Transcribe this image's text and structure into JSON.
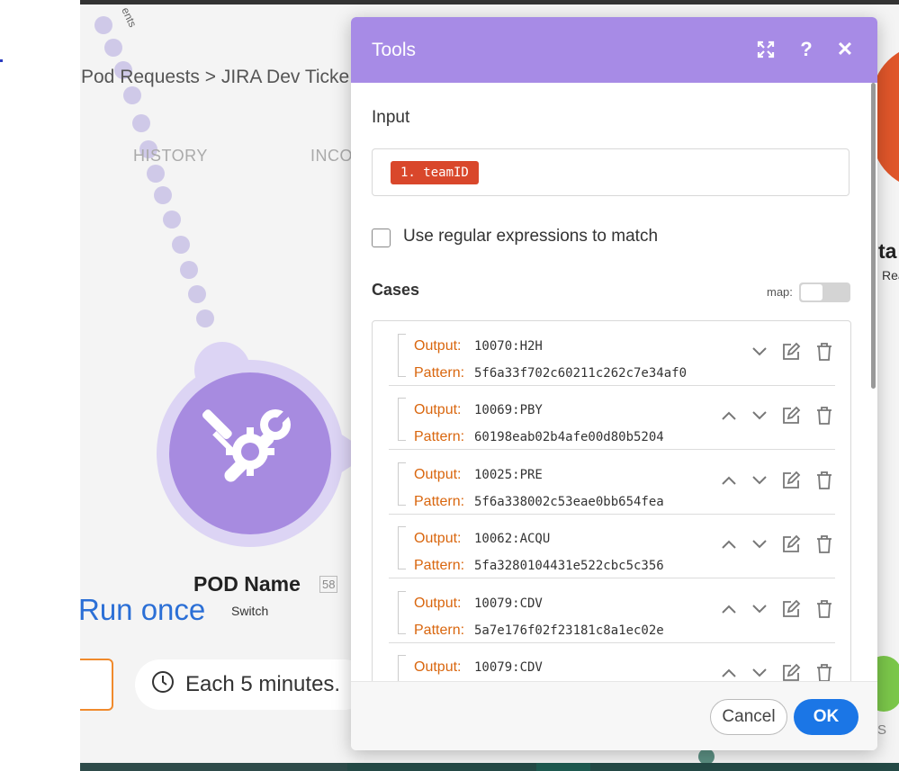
{
  "canvas": {
    "rotated_label": "ents",
    "breadcrumb": "Pod Requests > JIRA Dev Ticke",
    "tabs": [
      {
        "label": "HISTORY"
      },
      {
        "label": "INCO"
      }
    ],
    "module": {
      "name": "POD Name",
      "id": "58",
      "type": "Switch"
    },
    "run_once_label": "Run once",
    "schedule_label": "Each 5 minutes.",
    "right_module": {
      "title_fragment": "ta",
      "subtitle_fragment": "Rea"
    },
    "right_bottom_fragment": "S"
  },
  "dialog": {
    "title": "Tools",
    "header_icons": [
      "expand-icon",
      "help-icon",
      "close-icon"
    ],
    "input_label": "Input",
    "input_pill": "1. teamID",
    "regex_checkbox": {
      "label": "Use regular expressions to match",
      "checked": false
    },
    "cases_label": "Cases",
    "map_label": "map:",
    "map_enabled": false,
    "case_output_key": "Output:",
    "case_pattern_key": "Pattern:",
    "cases": [
      {
        "output": "10070:H2H",
        "pattern": "5f6a33f702c60211c262c7e34af0"
      },
      {
        "output": "10069:PBY",
        "pattern": "60198eab02b4afe00d80b5204"
      },
      {
        "output": "10025:PRE",
        "pattern": "5f6a338002c53eae0bb654fea"
      },
      {
        "output": "10062:ACQU",
        "pattern": "5fa3280104431e522cbc5c356"
      },
      {
        "output": "10079:CDV",
        "pattern": "5a7e176f02f23181c8a1ec02e"
      },
      {
        "output": "10079:CDV",
        "pattern": ""
      }
    ],
    "cancel_label": "Cancel",
    "ok_label": "OK"
  },
  "colors": {
    "header": "#a78be6",
    "module": "#a78be0",
    "pill": "#d9472b",
    "case_key": "#d9660e",
    "ok_button": "#1b76e6",
    "run_once": "#2b6fd6"
  }
}
